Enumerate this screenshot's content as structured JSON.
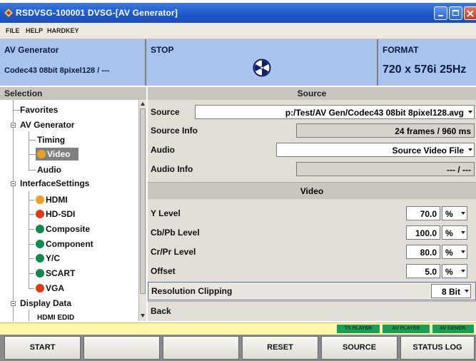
{
  "window": {
    "title": "RSDVSG-100001  DVSG-[AV Generator]"
  },
  "menu": {
    "items": [
      "FILE",
      "HELP",
      "HARDKEY"
    ]
  },
  "header": {
    "generator_label": "AV Generator",
    "generator_value": "Codec43 08bit 8pixel128 / ---",
    "state_label": "STOP",
    "format_label": "FORMAT",
    "format_value": "720 x 576i 25Hz"
  },
  "selection": {
    "title": "Selection",
    "tree": {
      "favorites": "Favorites",
      "av_generator": "AV Generator",
      "timing": "Timing",
      "video": "Video",
      "audio": "Audio",
      "interface_settings": "InterfaceSettings",
      "hdmi": "HDMI",
      "hd_sdi": "HD-SDI",
      "composite": "Composite",
      "component": "Component",
      "yc": "Y/C",
      "scart": "SCART",
      "vga": "VGA",
      "display_data": "Display Data",
      "hdmi_edid": "HDMI EDID"
    }
  },
  "source": {
    "title": "Source",
    "source_label": "Source",
    "source_value": "p:/Test/AV Gen/Codec43 08bit 8pixel128.avg",
    "source_info_label": "Source Info",
    "source_info_value": "24 frames / 960 ms",
    "audio_label": "Audio",
    "audio_value": "Source Video File",
    "audio_info_label": "Audio Info",
    "audio_info_value": "--- / ---"
  },
  "video": {
    "title": "Video",
    "y_level": {
      "label": "Y Level",
      "value": "70.0",
      "unit": "%"
    },
    "cb_level": {
      "label": "Cb/Pb Level",
      "value": "100.0",
      "unit": "%"
    },
    "cr_level": {
      "label": "Cr/Pr Level",
      "value": "80.0",
      "unit": "%"
    },
    "offset": {
      "label": "Offset",
      "value": "5.0",
      "unit": "%"
    },
    "resolution_clipping": {
      "label": "Resolution Clipping",
      "value": "8 Bit"
    },
    "back": "Back"
  },
  "status": {
    "indicators": [
      "TS PLAYER",
      "AV PLAYER",
      "AV GENER."
    ]
  },
  "softkeys": {
    "k1": "START",
    "k2": "",
    "k3": "",
    "k4": "RESET",
    "k5": "SOURCE",
    "k6": "STATUS LOG"
  },
  "colors": {
    "accent": "#a8c4ec",
    "title_bar": "#1f56c8",
    "ind_green": "#16a05a",
    "status_yellow": "#fff7a8"
  }
}
